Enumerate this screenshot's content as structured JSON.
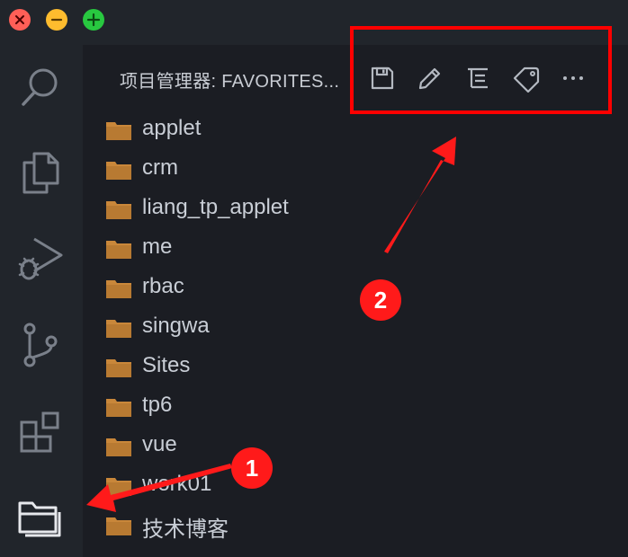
{
  "window": {
    "traffic_lights": [
      {
        "name": "close",
        "color": "#ff5f57"
      },
      {
        "name": "minimize",
        "color": "#febc2e"
      },
      {
        "name": "zoom",
        "color": "#28c840"
      }
    ]
  },
  "activity_bar": {
    "items": [
      {
        "icon": "search-icon"
      },
      {
        "icon": "explorer-files-icon"
      },
      {
        "icon": "run-debug-icon"
      },
      {
        "icon": "source-control-icon"
      },
      {
        "icon": "extensions-icon"
      },
      {
        "icon": "project-manager-icon"
      }
    ]
  },
  "panel": {
    "title": "项目管理器: FAVORITES...",
    "toolbar": [
      {
        "icon": "save-icon"
      },
      {
        "icon": "edit-pencil-icon"
      },
      {
        "icon": "filter-list-icon"
      },
      {
        "icon": "tag-icon"
      },
      {
        "icon": "more-actions-icon",
        "label": "···"
      }
    ]
  },
  "folders": [
    {
      "label": "applet"
    },
    {
      "label": "crm"
    },
    {
      "label": "liang_tp_applet"
    },
    {
      "label": "me"
    },
    {
      "label": "rbac"
    },
    {
      "label": "singwa"
    },
    {
      "label": "Sites"
    },
    {
      "label": "tp6"
    },
    {
      "label": "vue"
    },
    {
      "label": "work01"
    },
    {
      "label": "技术博客"
    }
  ],
  "annotations": {
    "badge_1": "1",
    "badge_2": "2",
    "accent_color": "#ff0000"
  },
  "colors": {
    "background": "#21252b",
    "sidebar": "#1b1d23",
    "folder": "#c9873a",
    "text": "#c9ced6"
  }
}
